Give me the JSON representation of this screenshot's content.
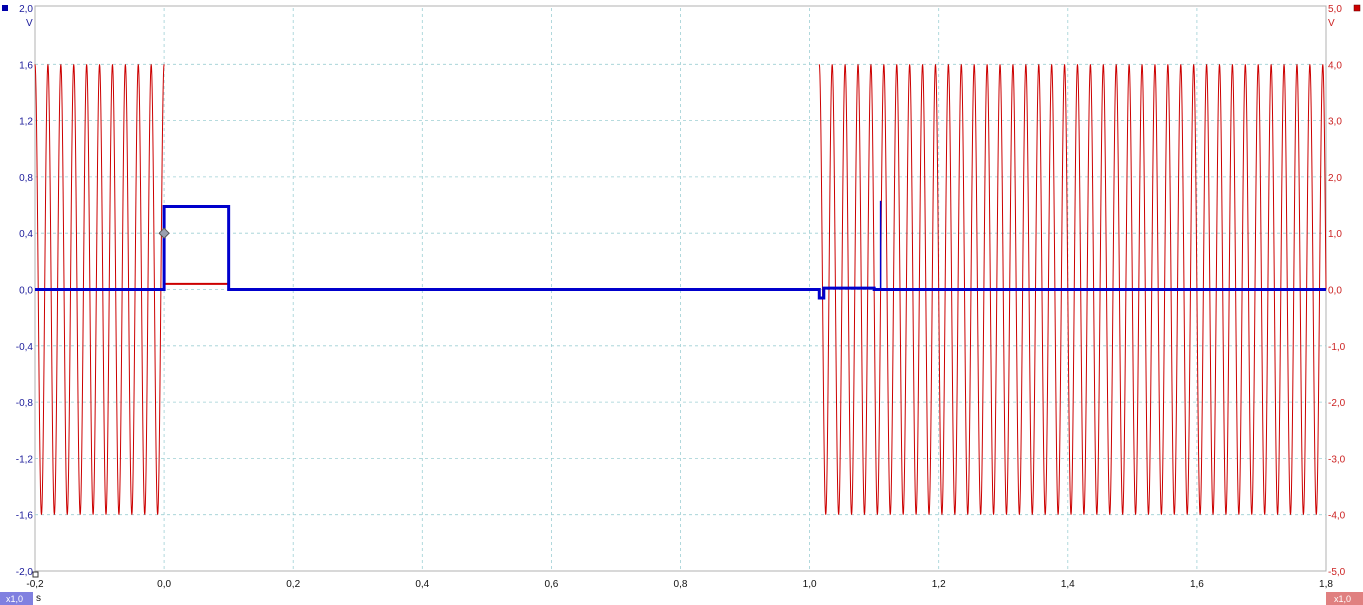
{
  "chart_data": {
    "type": "line",
    "x_unit": "s",
    "xlim": [
      -0.2,
      1.8
    ],
    "x_ticks": [
      "-0,2",
      "0,0",
      "0,2",
      "0,4",
      "0,6",
      "0,8",
      "1,0",
      "1,2",
      "1,4",
      "1,6",
      "1,8"
    ],
    "left_axis": {
      "unit": "V",
      "ylim": [
        -2.0,
        2.0
      ],
      "ticks": [
        "2,0",
        "1,6",
        "1,2",
        "0,8",
        "0,4",
        "0,0",
        "-0,4",
        "-0,8",
        "-1,2",
        "-1,6",
        "-2,0"
      ],
      "zoom_badge": "x1,0",
      "color": "#0000cc"
    },
    "right_axis": {
      "unit": "V",
      "ylim": [
        -5.0,
        5.0
      ],
      "ticks": [
        "5,0",
        "4,0",
        "3,0",
        "2,0",
        "1,0",
        "0,0",
        "-1,0",
        "-2,0",
        "-3,0",
        "-4,0",
        "-5,0"
      ],
      "zoom_badge": "x1,0",
      "color": "#cc0000"
    },
    "grid": true,
    "series": [
      {
        "axis": "right",
        "color": "#cc0000",
        "amplitude": 4.0,
        "frequency_hz": 50,
        "bursts": [
          [
            -0.2,
            0.0
          ],
          [
            1.015,
            1.8
          ]
        ],
        "segments": [
          {
            "x": [
              0.0,
              0.1
            ],
            "y": [
              0.1,
              0.1
            ]
          }
        ]
      },
      {
        "axis": "left",
        "color": "#0000cc",
        "pulses": [
          {
            "x": [
              -0.2,
              0.0,
              0.0,
              0.1,
              0.1,
              1.015,
              1.015,
              1.022,
              1.022,
              1.1,
              1.1,
              1.8
            ],
            "y": [
              0.0,
              0.0,
              0.59,
              0.59,
              0.0,
              0.0,
              -0.06,
              -0.06,
              0.01,
              0.01,
              0.0,
              0.0
            ]
          }
        ],
        "spikes": [
          {
            "x": 1.11,
            "y": 0.63
          }
        ]
      }
    ],
    "trigger_marker": {
      "x": 0.0,
      "y": 0.4
    }
  }
}
